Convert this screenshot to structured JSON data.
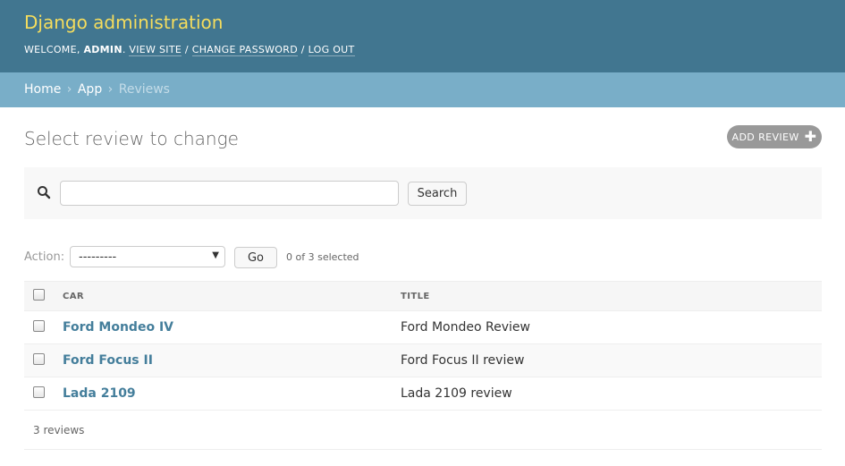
{
  "header": {
    "brand": "Django administration",
    "welcome": "WELCOME,",
    "username": "ADMIN",
    "view_site": "VIEW SITE",
    "change_password": "CHANGE PASSWORD",
    "log_out": "LOG OUT",
    "separator": "/"
  },
  "breadcrumbs": {
    "home": "Home",
    "app": "App",
    "current": "Reviews",
    "arrow": "›"
  },
  "content": {
    "title": "Select review to change",
    "add_button": "ADD REVIEW",
    "add_icon": "plus-icon"
  },
  "search": {
    "value": "",
    "placeholder": "",
    "button": "Search",
    "icon": "search-icon"
  },
  "actions": {
    "label": "Action:",
    "selected_option": "---------",
    "go": "Go",
    "selected_count": "0 of 3 selected"
  },
  "table": {
    "columns": [
      "CAR",
      "TITLE"
    ],
    "rows": [
      {
        "car": "Ford Mondeo IV",
        "title": "Ford Mondeo Review"
      },
      {
        "car": "Ford Focus II",
        "title": "Ford Focus II review"
      },
      {
        "car": "Lada 2109",
        "title": "Lada 2109 review"
      }
    ],
    "count": "3 reviews"
  },
  "colors": {
    "header_bg": "#417690",
    "brand": "#f5dd5d",
    "breadcrumbs_bg": "#79aec8",
    "link": "#447e9b",
    "add_button_bg": "#999999"
  }
}
